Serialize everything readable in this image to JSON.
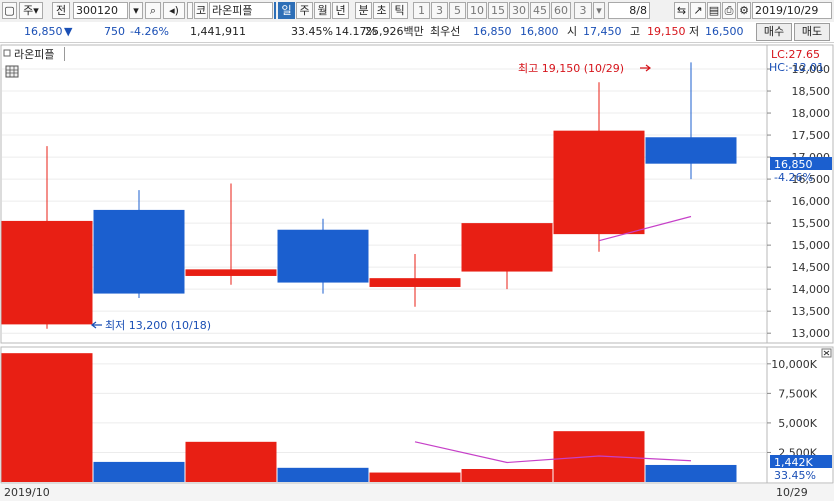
{
  "toolbar": {
    "mode": "주",
    "prefix": "전",
    "code": "300120",
    "market": "코",
    "name": "라온피플",
    "periods": [
      {
        "label": "일",
        "selected": true
      },
      {
        "label": "주",
        "selected": false
      },
      {
        "label": "월",
        "selected": false
      },
      {
        "label": "년",
        "selected": false
      },
      {
        "label": "분",
        "selected": false
      },
      {
        "label": "초",
        "selected": false
      },
      {
        "label": "틱",
        "selected": false
      }
    ],
    "intervals": [
      "1",
      "3",
      "5",
      "10",
      "15",
      "30",
      "45",
      "60"
    ],
    "interval_value": "3",
    "page": "8/8",
    "date": "2019/10/29"
  },
  "info": {
    "price": "16,850",
    "change": "750",
    "change_pct": "-4.26%",
    "volume": "1,441,911",
    "vol_ratio": "33.45%",
    "turnover": "14.17%",
    "amount": "25,926백만",
    "best_label": "최우선",
    "best_sell": "16,850",
    "best_buy": "16,800",
    "open_label": "시",
    "open": "17,450",
    "high_label": "고",
    "high": "19,150",
    "low_label": "저",
    "low": "16,500",
    "buy_button": "매수",
    "sell_button": "매도"
  },
  "legend": {
    "stock_name": "라온피플",
    "lc": "LC:27.65",
    "hc": "HC:-12.01",
    "high_marker": "최고 19,150 (10/29)",
    "low_marker": "최저 13,200 (10/18)",
    "last_price": "16,850",
    "last_pct": "-4.26%",
    "last_volume": "1,442K",
    "last_vol_pct": "33.45%",
    "x_start": "2019/10",
    "x_end": "10/29"
  },
  "colors": {
    "up": "#e81f14",
    "down": "#1b5fcf",
    "ma": "#c640c8"
  },
  "chart_data": {
    "type": "candlestick",
    "price_axis": {
      "ticks": [
        "13,000",
        "13,500",
        "14,000",
        "14,500",
        "15,000",
        "15,500",
        "16,000",
        "16,500",
        "17,000",
        "17,500",
        "18,000",
        "18,500",
        "19,000"
      ],
      "range": [
        12800,
        19500
      ]
    },
    "volume_axis": {
      "ticks": [
        "2,500K",
        "5,000K",
        "7,500K",
        "10,000K"
      ],
      "range": [
        0,
        11000000
      ]
    },
    "candles": [
      {
        "open": 13200,
        "high": 17250,
        "low": 13100,
        "close": 15550,
        "volume": 10900000
      },
      {
        "open": 15800,
        "high": 16250,
        "low": 13800,
        "close": 13900,
        "volume": 1700000
      },
      {
        "open": 14300,
        "high": 16400,
        "low": 14100,
        "close": 14450,
        "volume": 3400000
      },
      {
        "open": 15350,
        "high": 15600,
        "low": 13900,
        "close": 14150,
        "volume": 1200000
      },
      {
        "open": 14050,
        "high": 14800,
        "low": 13600,
        "close": 14250,
        "volume": 800000
      },
      {
        "open": 14400,
        "high": 14850,
        "low": 14000,
        "close": 15500,
        "volume": 1100000
      },
      {
        "open": 15250,
        "high": 18700,
        "low": 14850,
        "close": 17600,
        "volume": 4300000
      },
      {
        "open": 17450,
        "high": 19150,
        "low": 16500,
        "close": 16850,
        "volume": 1442000
      }
    ],
    "ma_price": [
      null,
      null,
      null,
      null,
      null,
      null,
      15100,
      15650
    ],
    "ma_volume": [
      null,
      null,
      null,
      null,
      3400000,
      1650000,
      2200000,
      1800000
    ]
  }
}
